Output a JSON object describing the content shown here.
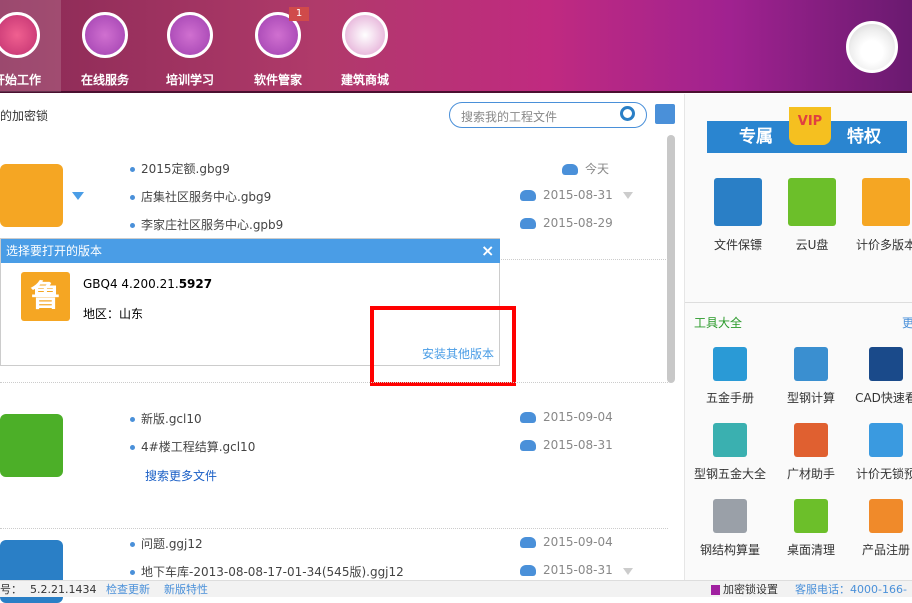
{
  "header": {
    "nav": [
      {
        "label": "开始工作",
        "icon": "lipstick-icon"
      },
      {
        "label": "在线服务",
        "icon": "handbag-icon"
      },
      {
        "label": "培训学习",
        "icon": "mascara-icon"
      },
      {
        "label": "软件管家",
        "icon": "brush-cup-icon",
        "badge": "1"
      },
      {
        "label": "建筑商城",
        "icon": "mirror-icon"
      }
    ]
  },
  "left": {
    "lock_label": "的加密锁",
    "search_placeholder": "搜索我的工程文件",
    "groups": [
      {
        "icon": "gbq-pricing-icon",
        "color": "#f5a623",
        "files": [
          {
            "name": "2015定额.gbg9",
            "date": "今天"
          },
          {
            "name": "店集社区服务中心.gbg9",
            "date": "2015-08-31"
          },
          {
            "name": "李家庄社区服务中心.gpb9",
            "date": "2015-08-29"
          }
        ]
      },
      {
        "icon": "gcl-quantity-icon",
        "color": "#4caf28",
        "files": [
          {
            "name": "新版.gcl10",
            "date": "2015-09-04"
          },
          {
            "name": "4#楼工程结算.gcl10",
            "date": "2015-08-31"
          }
        ],
        "more": "搜索更多文件"
      },
      {
        "icon": "ggj-rebar-icon",
        "color": "#2a7fc6",
        "files": [
          {
            "name": "问题.ggj12",
            "date": "2015-09-04"
          },
          {
            "name": "地下车库-2013-08-08-17-01-34(545版).ggj12",
            "date": "2015-08-31"
          }
        ]
      }
    ],
    "popup": {
      "title": "选择要打开的版本",
      "close": "×",
      "version_prefix": "GBQ4 4.200.21.",
      "version_bold": "5927",
      "region": "地区：山东",
      "region_glyph": "鲁",
      "install_other": "安装其他版本"
    },
    "highlight_color": "#ff0000"
  },
  "right": {
    "vip": {
      "left": "专属",
      "crown": "VIP",
      "right": "特权"
    },
    "vip_items": [
      {
        "label": "文件保镖",
        "color": "#2a7fc6"
      },
      {
        "label": "云U盘",
        "color": "#6cbf2a"
      },
      {
        "label": "计价多版本",
        "color": "#f5a623"
      }
    ],
    "tools_title": "工具大全",
    "more": "更",
    "tools": [
      {
        "label": "五金手册",
        "color": "#2a9ad6"
      },
      {
        "label": "型钢计算",
        "color": "#3a8fd0"
      },
      {
        "label": "CAD快速看",
        "color": "#1a4a8a"
      },
      {
        "label": "型钢五金大全",
        "color": "#3ab0b0"
      },
      {
        "label": "广材助手",
        "color": "#e06030"
      },
      {
        "label": "计价无锁预",
        "color": "#3a9ae0"
      },
      {
        "label": "钢结构算量",
        "color": "#9aa0a8"
      },
      {
        "label": "桌面清理",
        "color": "#6cbf2a"
      },
      {
        "label": "产品注册",
        "color": "#f08a2a"
      }
    ]
  },
  "status": {
    "version_label": "号：",
    "version": "5.2.21.1434",
    "check_update": "检查更新",
    "new_features": "新版特性",
    "lock_settings": "加密锁设置",
    "hotline": "客服电话：4000-166-"
  }
}
